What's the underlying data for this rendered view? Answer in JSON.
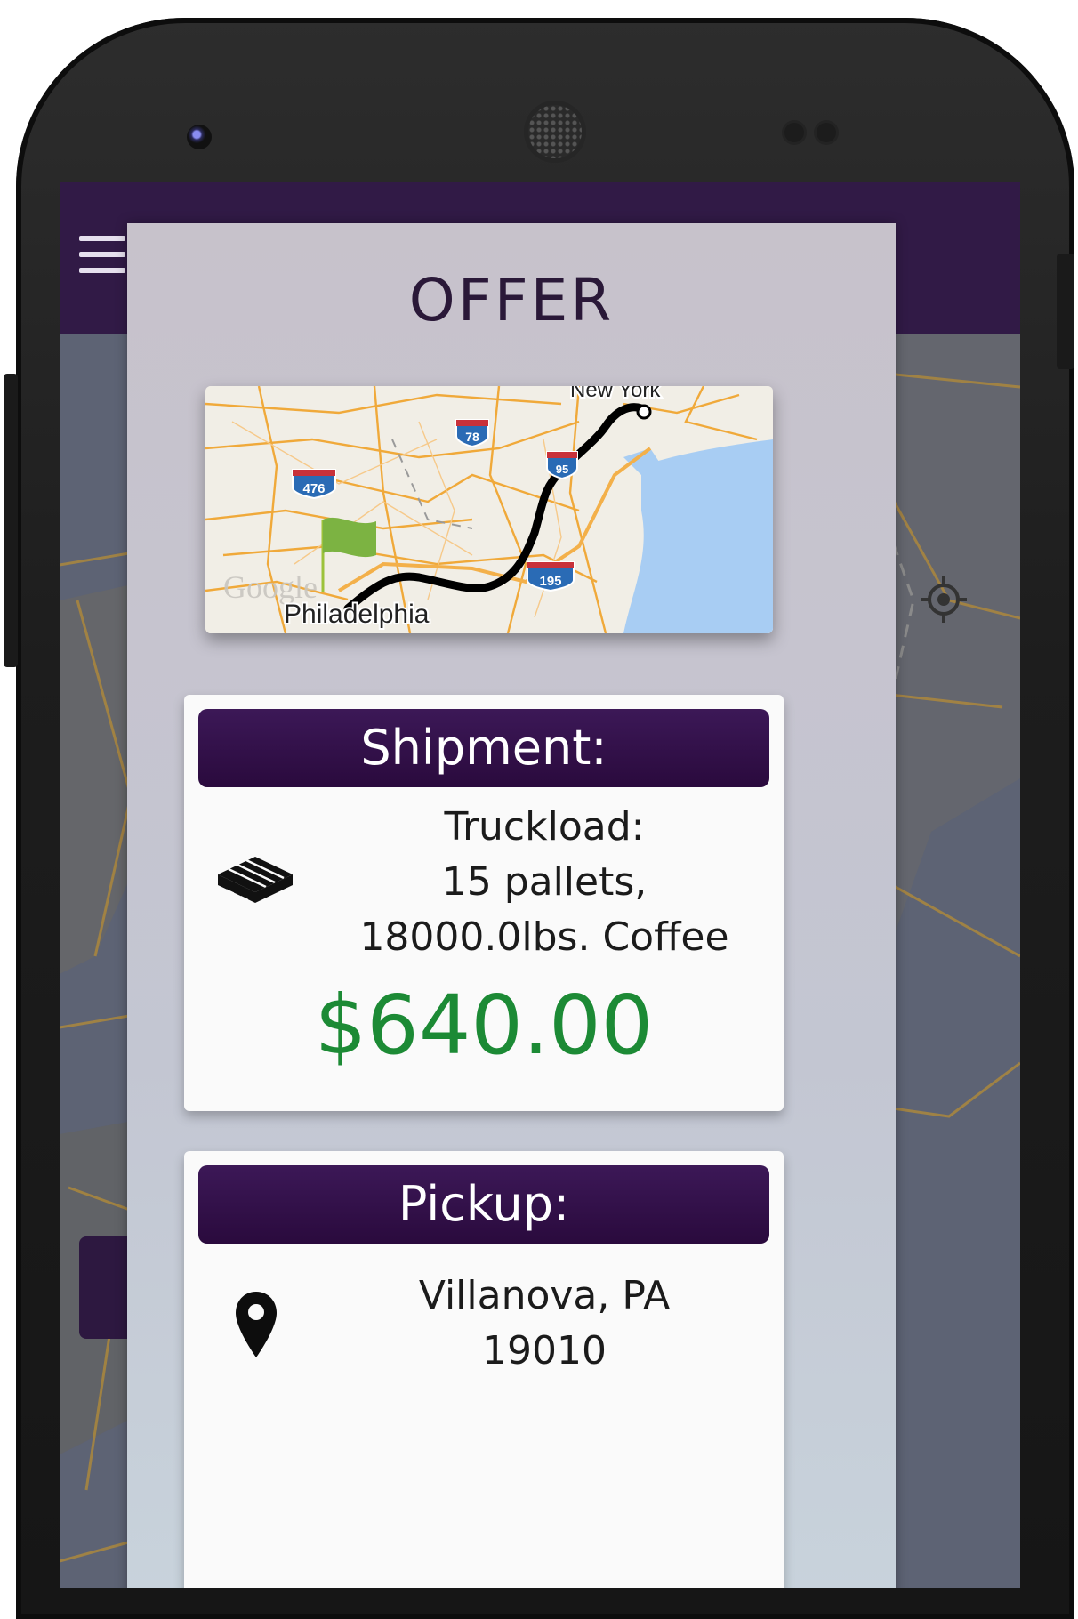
{
  "dialog": {
    "title": "OFFER"
  },
  "route_map": {
    "origin_label": "Philadelphia",
    "destination_label": "New York",
    "watermark": "Google",
    "shields": [
      "78",
      "476",
      "195",
      "95"
    ]
  },
  "shipment": {
    "header": "Shipment:",
    "line1": "Truckload:",
    "line2": "15 pallets,",
    "line3": "18000.0lbs. Coffee",
    "price": "$640.00",
    "icon": "pallet-icon"
  },
  "pickup": {
    "header": "Pickup:",
    "line1": "Villanova, PA",
    "line2": "19010",
    "icon": "location-pin-icon"
  },
  "colors": {
    "appbar": "#311a46",
    "card_header": "#2a0a3d",
    "price": "#1c8a35",
    "route": "#000000",
    "water": "#a8cdf3",
    "flag": "#7cb342"
  }
}
